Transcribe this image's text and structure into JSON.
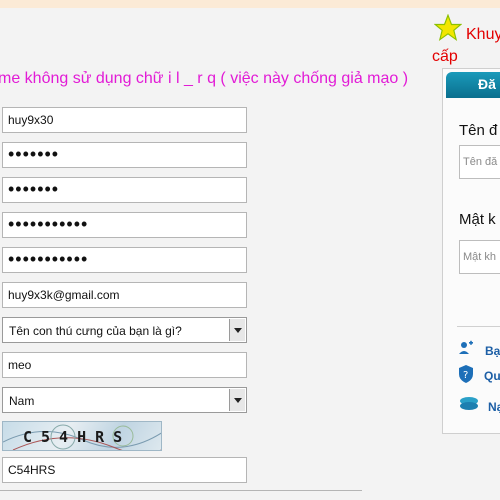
{
  "notice": "me không sử dụng chữ i l _ r q ( việc này chống giả mạo )",
  "form": {
    "username": "huy9x30",
    "password": "•••••••",
    "password_confirm": "•••••••",
    "password2": "•••••••••••",
    "password2_confirm": "•••••••••••",
    "email": "huy9x3k@gmail.com",
    "security_question": "Tên con thú cưng của bạn là gì?",
    "security_answer": "meo",
    "gender": "Nam",
    "captcha_image_text": "C54HRS",
    "captcha_value": "C54HRS"
  },
  "promo": {
    "title": "Khuy",
    "subtitle": "cấp"
  },
  "login": {
    "tab_label": "Đă",
    "username_label": "Tên đ",
    "username_placeholder": "Tên đă",
    "password_label": "Mật k",
    "password_placeholder": "Mật kh",
    "links": [
      "Bạ",
      "Qu",
      "Nạ"
    ]
  },
  "colors": {
    "notice": "#e21bd6",
    "promo": "#e30000",
    "tab": "#0f86a8",
    "link": "#1d5fa6"
  },
  "icons": [
    "star-icon",
    "add-user-icon",
    "shield-question-icon",
    "coins-icon"
  ]
}
